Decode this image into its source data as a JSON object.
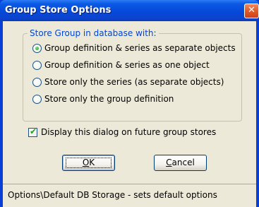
{
  "window": {
    "title": "Group Store Options",
    "close_glyph": "✕"
  },
  "group": {
    "legend": "Store Group in database with:",
    "options": [
      {
        "label": "Group definition & series as separate objects",
        "selected": true
      },
      {
        "label": "Group definition & series as one object",
        "selected": false
      },
      {
        "label": "Store only the series (as separate objects)",
        "selected": false
      },
      {
        "label": "Store only the group definition",
        "selected": false
      }
    ]
  },
  "checkbox": {
    "label": "Display this dialog on future group stores",
    "checked": true
  },
  "buttons": {
    "ok": {
      "mnemonic": "O",
      "rest": "K"
    },
    "cancel": {
      "mnemonic": "C",
      "rest": "ancel"
    }
  },
  "status": {
    "text": "Options\\Default DB Storage - sets default options"
  },
  "colors": {
    "titlebar": "#0648d8",
    "client_bg": "#ece9d8",
    "legend_text": "#0046d5",
    "close_button": "#e05a2b"
  }
}
